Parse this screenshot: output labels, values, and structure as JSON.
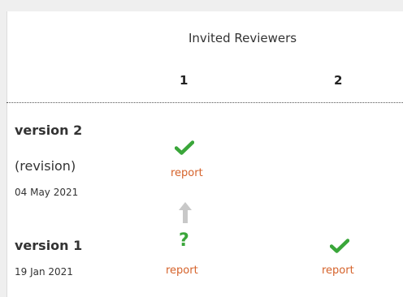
{
  "header": {
    "title": "Invited Reviewers",
    "columns": [
      "1",
      "2"
    ]
  },
  "versions": [
    {
      "label": "version 2",
      "description": "(revision)",
      "date": "04 May 2021",
      "reports": [
        {
          "reviewer": "1",
          "status": "approved",
          "icon": "checkmark-icon",
          "link_text": "report"
        }
      ]
    },
    {
      "label": "version 1",
      "description": "",
      "date": "19 Jan 2021",
      "reports": [
        {
          "reviewer": "1",
          "status": "approved-with-reservations",
          "icon": "question-mark-icon",
          "symbol": "?",
          "link_text": "report"
        },
        {
          "reviewer": "2",
          "status": "approved",
          "icon": "checkmark-icon",
          "link_text": "report"
        }
      ]
    }
  ],
  "colors": {
    "approved": "#3aa63a",
    "link": "#d5622a",
    "arrow": "#c8c8c8"
  }
}
